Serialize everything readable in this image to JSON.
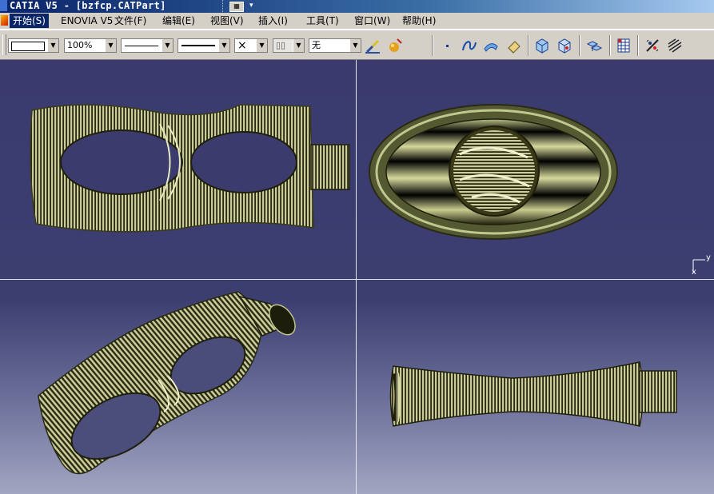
{
  "window": {
    "title": "CATIA V5 - [bzfcp.CATPart]"
  },
  "menubar": {
    "items": [
      {
        "label": "开始(S)",
        "active": true
      },
      {
        "label": "ENOVIA V5",
        "active": false
      },
      {
        "label": "文件(F)",
        "active": false
      },
      {
        "label": "编辑(E)",
        "active": false
      },
      {
        "label": "视图(V)",
        "active": false
      },
      {
        "label": "插入(I)",
        "active": false
      },
      {
        "label": "工具(T)",
        "active": false
      },
      {
        "label": "窗口(W)",
        "active": false
      },
      {
        "label": "帮助(H)",
        "active": false
      }
    ]
  },
  "toolbar": {
    "color_combo": "",
    "zoom_combo": "100%",
    "linetype_combo": "",
    "lineweight_combo": "",
    "point_style_combo": "×",
    "layer_combo": "",
    "name_combo": "无",
    "icons": [
      "painter-icon",
      "apply-material-icon",
      "point-icon",
      "curve-icon",
      "surface-icon",
      "eraser-icon",
      "front-view-icon",
      "back-view-icon",
      "multi-view-icon",
      "grid-icon",
      "snap-icon",
      "hatch-icon"
    ]
  },
  "viewport": {
    "background_top": "#3a3a6e",
    "background_bottom": "#a2a5c1",
    "model_color": "#9ea472",
    "axis": {
      "y_label": "y",
      "x_label": "x"
    }
  }
}
